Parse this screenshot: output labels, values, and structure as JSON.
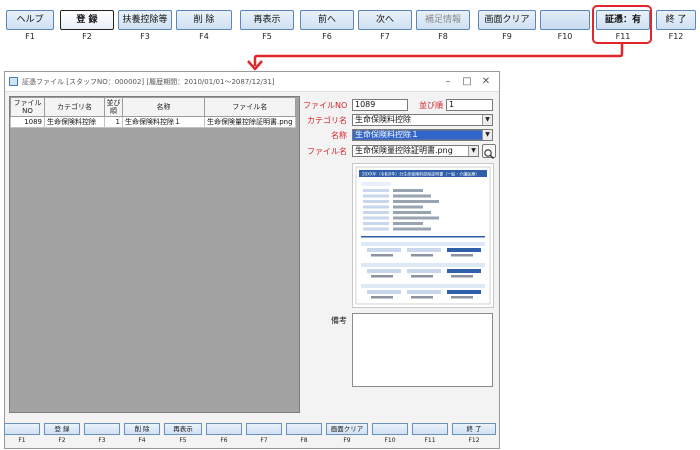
{
  "top_keys": [
    {
      "label": "ヘルプ",
      "key": "F1",
      "state": "normal"
    },
    {
      "label": "登 録",
      "key": "F2",
      "state": "pressed"
    },
    {
      "label": "扶養控除等",
      "key": "F3",
      "state": "normal"
    },
    {
      "label": "削 除",
      "key": "F4",
      "state": "normal"
    },
    {
      "label": "再表示",
      "key": "F5",
      "state": "normal"
    },
    {
      "label": "前へ",
      "key": "F6",
      "state": "normal"
    },
    {
      "label": "次へ",
      "key": "F7",
      "state": "normal"
    },
    {
      "label": "補足情報",
      "key": "F8",
      "state": "disabled"
    },
    {
      "label": "画面クリア",
      "key": "F9",
      "state": "normal"
    },
    {
      "label": "",
      "key": "F10",
      "state": "blank"
    },
    {
      "label": "証憑：有",
      "key": "F11",
      "state": "normal"
    },
    {
      "label": "終 了",
      "key": "F12",
      "state": "normal"
    }
  ],
  "window": {
    "title": "証憑ファイル [スタッフNO：000002] [履歴期間：2010/01/01～2087/12/31]",
    "minimize": "–",
    "maximize": "□",
    "close": "✕"
  },
  "grid": {
    "columns": [
      "ファイル\nNO",
      "カテゴリ名",
      "並び\n順",
      "名称",
      "ファイル名"
    ],
    "rows": [
      [
        "1089",
        "生命保険料控除",
        "1",
        "生命保険料控除１",
        "生命保険量控除証明書.png"
      ]
    ]
  },
  "form": {
    "file_no_label": "ファイルNO",
    "file_no_value": "1089",
    "order_label": "並び順",
    "order_value": "1",
    "category_label": "カテゴリ名",
    "category_value": "生命保険料控除",
    "name_label": "名称",
    "name_value": "生命保険料控除１",
    "filename_label": "ファイル名",
    "filename_value": "生命保険量控除証明書.png",
    "memo_label": "備考",
    "memo_value": ""
  },
  "thumbnail": {
    "heading": "20XX年（令和X年）分生命保険料控除証明書（一般・介護医療）"
  },
  "bottom_keys": [
    {
      "label": "",
      "key": "F1"
    },
    {
      "label": "登 録",
      "key": "F2"
    },
    {
      "label": "",
      "key": "F3"
    },
    {
      "label": "削 除",
      "key": "F4"
    },
    {
      "label": "再表示",
      "key": "F5"
    },
    {
      "label": "",
      "key": "F6"
    },
    {
      "label": "",
      "key": "F7"
    },
    {
      "label": "",
      "key": "F8"
    },
    {
      "label": "画面クリア",
      "key": "F9"
    },
    {
      "label": "",
      "key": "F10"
    },
    {
      "label": "",
      "key": "F11"
    },
    {
      "label": "終 了",
      "key": "F12"
    }
  ],
  "colors": {
    "required_label": "#d2232a",
    "callout": "#e0262a",
    "selection": "#3366cc",
    "thumbnail_header": "#2f5fa8"
  }
}
